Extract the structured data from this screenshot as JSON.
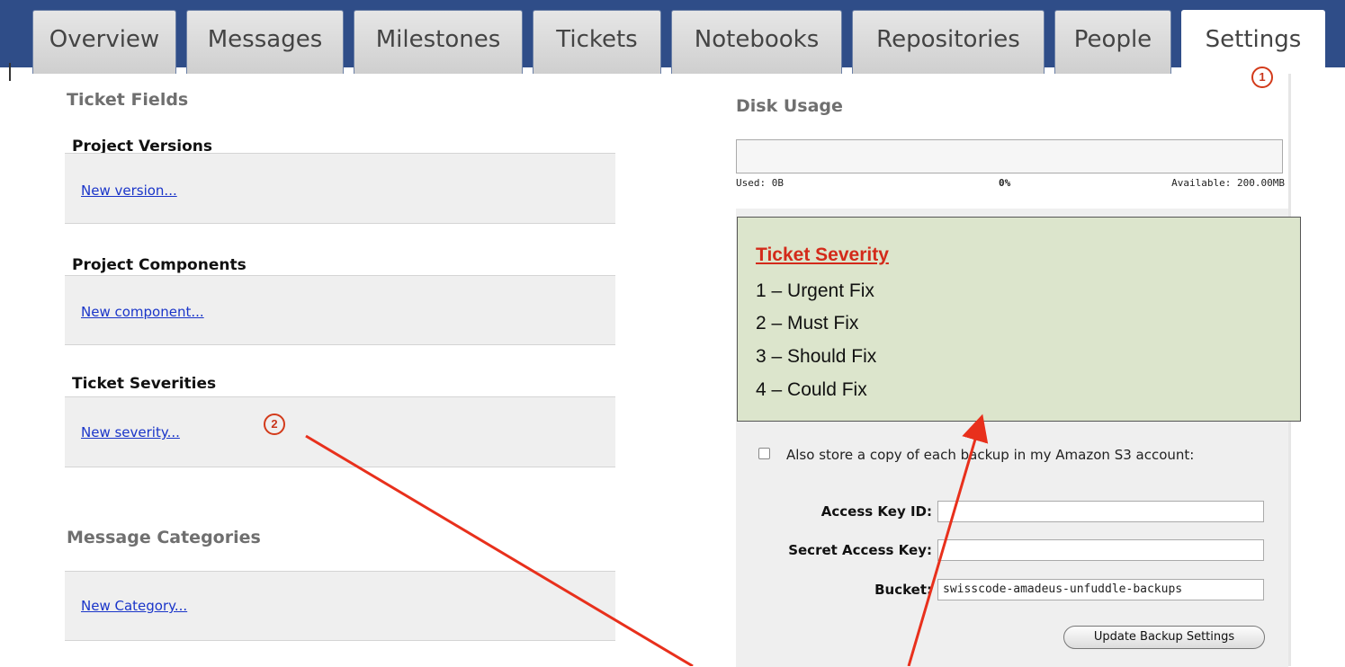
{
  "tabs": [
    {
      "label": "Overview"
    },
    {
      "label": "Messages"
    },
    {
      "label": "Milestones"
    },
    {
      "label": "Tickets"
    },
    {
      "label": "Notebooks"
    },
    {
      "label": "Repositories"
    },
    {
      "label": "People"
    },
    {
      "label": "Settings",
      "active": true
    }
  ],
  "left": {
    "ticket_fields_title": "Ticket Fields",
    "groups": [
      {
        "label": "Project Versions",
        "link": "New version..."
      },
      {
        "label": "Project Components",
        "link": "New component..."
      },
      {
        "label": "Ticket Severities",
        "link": "New severity..."
      }
    ],
    "message_categories_title": "Message Categories",
    "message_categories_link": "New Category..."
  },
  "right": {
    "disk_usage_title": "Disk Usage",
    "used": "Used: 0B",
    "percent": "0%",
    "available": "Available: 200.00MB",
    "disk_fraction": 0,
    "s3_text": "Also store a copy of each backup in my Amazon S3 account:",
    "fields": {
      "access_key_label": "Access Key ID:",
      "access_key_value": "",
      "secret_key_label": "Secret Access Key:",
      "secret_key_value": "",
      "bucket_label": "Bucket:",
      "bucket_value": "swisscode-amadeus-unfuddle-backups"
    },
    "update_button": "Update Backup Settings"
  },
  "callout": {
    "title": "Ticket Severity",
    "lines": [
      "1 – Urgent Fix",
      "2 – Must Fix",
      "3 – Should Fix",
      "4 – Could Fix"
    ]
  },
  "markers": {
    "one": "1",
    "two": "2"
  },
  "colors": {
    "header": "#2f4d88",
    "annotation": "#e8301c",
    "callout_bg": "#dce5cc",
    "link": "#1a35c9"
  }
}
